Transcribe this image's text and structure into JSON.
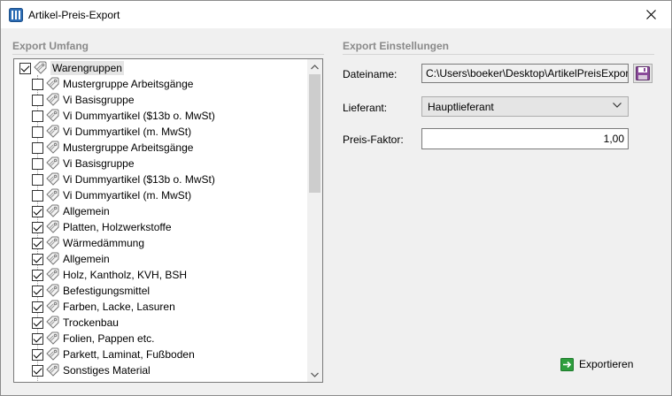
{
  "window": {
    "title": "Artikel-Preis-Export"
  },
  "export_umfang": {
    "title": "Export Umfang",
    "root": {
      "label": "Warengruppen",
      "checked": true
    },
    "items": [
      {
        "label": "Mustergruppe Arbeitsgänge",
        "checked": false
      },
      {
        "label": "Vi Basisgruppe",
        "checked": false
      },
      {
        "label": "Vi Dummyartikel ($13b o. MwSt)",
        "checked": false
      },
      {
        "label": "Vi Dummyartikel (m. MwSt)",
        "checked": false
      },
      {
        "label": "Mustergruppe Arbeitsgänge",
        "checked": false
      },
      {
        "label": "Vi Basisgruppe",
        "checked": false
      },
      {
        "label": "Vi Dummyartikel ($13b o. MwSt)",
        "checked": false
      },
      {
        "label": "Vi Dummyartikel (m. MwSt)",
        "checked": false
      },
      {
        "label": "Allgemein",
        "checked": true
      },
      {
        "label": "Platten, Holzwerkstoffe",
        "checked": true
      },
      {
        "label": "Wärmedämmung",
        "checked": true
      },
      {
        "label": "Allgemein",
        "checked": true
      },
      {
        "label": "Holz, Kantholz, KVH, BSH",
        "checked": true
      },
      {
        "label": "Befestigungsmittel",
        "checked": true
      },
      {
        "label": "Farben, Lacke, Lasuren",
        "checked": true
      },
      {
        "label": "Trockenbau",
        "checked": true
      },
      {
        "label": "Folien, Pappen etc.",
        "checked": true
      },
      {
        "label": "Parkett, Laminat, Fußboden",
        "checked": true
      },
      {
        "label": "Sonstiges Material",
        "checked": true
      }
    ]
  },
  "export_einstellungen": {
    "title": "Export Einstellungen",
    "dateiname": {
      "label": "Dateiname:",
      "value": "C:\\Users\\boeker\\Desktop\\ArtikelPreisExport"
    },
    "lieferant": {
      "label": "Lieferant:",
      "value": "Hauptlieferant"
    },
    "preis_faktor": {
      "label": "Preis-Faktor:",
      "value": "1,00"
    }
  },
  "actions": {
    "export_label": "Exportieren"
  },
  "colors": {
    "accent_green": "#2e9e3e",
    "save_purple": "#8a4a9a"
  }
}
